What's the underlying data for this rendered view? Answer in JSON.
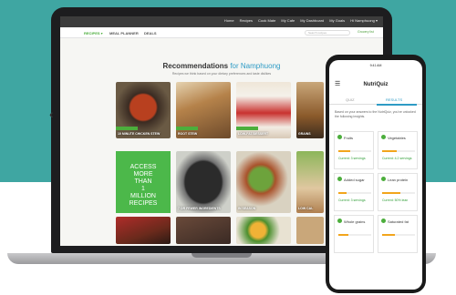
{
  "colors": {
    "teal": "#3fa6a2",
    "accent_green": "#4cae3c",
    "link_blue": "#2e9bc5",
    "orange": "#f2a51c"
  },
  "laptop": {
    "topnav": [
      "Home",
      "Recipes",
      "Cook Mate",
      "My Cafe",
      "My Dashboard",
      "My Goals",
      "Hi Namphuong ▾"
    ],
    "nav": {
      "recipes": "RECIPES ▾",
      "meal_planner": "MEAL PLANNER",
      "deals": "DEALS",
      "search_placeholder": "Search recipes",
      "grocery": "Grocery list"
    },
    "heading": {
      "prefix": "Recommendations",
      "connector": "for",
      "user": "Namphuong"
    },
    "subheading": "Recipes we think based on your dietary preferences and taste dislikes",
    "carousel_arrow": "‹",
    "cards_row1": [
      {
        "caption": "10 MINUTE CHICKEN STEW",
        "tag": true
      },
      {
        "caption": "ROOT STEW",
        "tag": true
      },
      {
        "caption": "LOW-FAT/DESSERT",
        "tag": true
      },
      {
        "caption": "GRAINS",
        "tag": false
      }
    ],
    "promo": [
      "ACCESS",
      "MORE",
      "THAN",
      "1",
      "MILLION",
      "RECIPES"
    ],
    "cards_row2": [
      {
        "caption": "7 OR FEWER INGREDIENTS"
      },
      {
        "caption": "IN SEASON"
      },
      {
        "caption": "LOW CAL"
      }
    ]
  },
  "phone": {
    "status_time": "9:41 AM",
    "menu_icon": "☰",
    "app_title": "NutriQuiz",
    "tabs": {
      "quiz": "QUIZ",
      "results": "RESULTS"
    },
    "intro": "Based on your answers to the NutriQuiz, you've unlocked the following insights.",
    "tiles": [
      {
        "name": "Fruits",
        "fill": 0.35,
        "result": "Current: 3 servings"
      },
      {
        "name": "Vegetables",
        "fill": 0.45,
        "result": "Current: 4.2 servings"
      },
      {
        "name": "Added sugar",
        "fill": 0.25,
        "result": "Current: 3 servings"
      },
      {
        "name": "Lean protein",
        "fill": 0.55,
        "result": "Current: 50% lean"
      },
      {
        "name": "Whole grains",
        "fill": 0.3,
        "result": ""
      },
      {
        "name": "Saturated fat",
        "fill": 0.4,
        "result": ""
      }
    ]
  }
}
